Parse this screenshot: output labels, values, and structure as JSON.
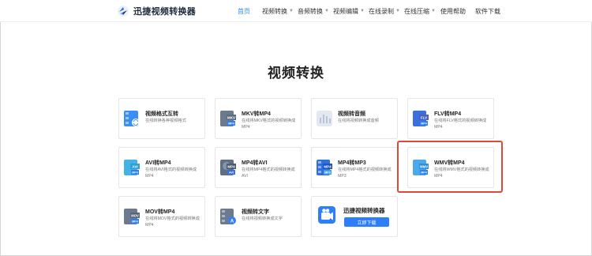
{
  "header": {
    "logo_text": "迅捷视频转换器",
    "nav": [
      {
        "label": "首页",
        "active": true,
        "dropdown": false
      },
      {
        "label": "视频转换",
        "active": false,
        "dropdown": true
      },
      {
        "label": "音频转换",
        "active": false,
        "dropdown": true
      },
      {
        "label": "视频编辑",
        "active": false,
        "dropdown": true
      },
      {
        "label": "在线录制",
        "active": false,
        "dropdown": true
      },
      {
        "label": "在线压缩",
        "active": false,
        "dropdown": true
      },
      {
        "label": "使用帮助",
        "active": false,
        "dropdown": false
      },
      {
        "label": "软件下载",
        "active": false,
        "dropdown": false
      }
    ]
  },
  "main": {
    "title": "视频转换",
    "cards": [
      {
        "title": "视频格式互转",
        "desc": "在线转换各种视频格式",
        "icon": "video-format-icon",
        "badge": ""
      },
      {
        "title": "MKV转MP4",
        "desc": "在线将MKV格式的视频转换成MP4",
        "icon": "mkv-to-mp4-icon",
        "badge": "MKV"
      },
      {
        "title": "视频转音频",
        "desc": "在线将视频转换成音频",
        "icon": "video-to-audio-icon",
        "badge": ""
      },
      {
        "title": "FLV转MP4",
        "desc": "在线将FLV格式的视频转换成MP4",
        "icon": "flv-to-mp4-icon",
        "badge": "FLV"
      },
      {
        "title": "AVI转MP4",
        "desc": "在线将AVI格式的视频转换成MP4",
        "icon": "avi-to-mp4-icon",
        "badge": "AVI"
      },
      {
        "title": "MP4转AVI",
        "desc": "在线将MP4格式的视频转换成AVI",
        "icon": "mp4-to-avi-icon",
        "badge": "MP4"
      },
      {
        "title": "MP4转MP3",
        "desc": "在线将MP4格式的视频转换成MP3",
        "icon": "mp4-to-mp3-icon",
        "badge": "MP4"
      },
      {
        "title": "WMV转MP4",
        "desc": "在线将WMV格式的视频转换成MP4",
        "icon": "wmv-to-mp4-icon",
        "badge": "WMV"
      },
      {
        "title": "MOV转MP4",
        "desc": "在线将MOV格式的视频转换成MP4",
        "icon": "mov-to-mp4-icon",
        "badge": "MOV"
      },
      {
        "title": "视频转文字",
        "desc": "在线将视频转换成文字",
        "icon": "video-to-text-icon",
        "badge": ""
      }
    ],
    "promo": {
      "title": "迅捷视频转换器",
      "button": "立即下载",
      "icon": "app-icon"
    }
  },
  "colors": {
    "accent": "#2d8cf0",
    "highlight": "#d94b3c",
    "button": "#2d7ff9"
  }
}
